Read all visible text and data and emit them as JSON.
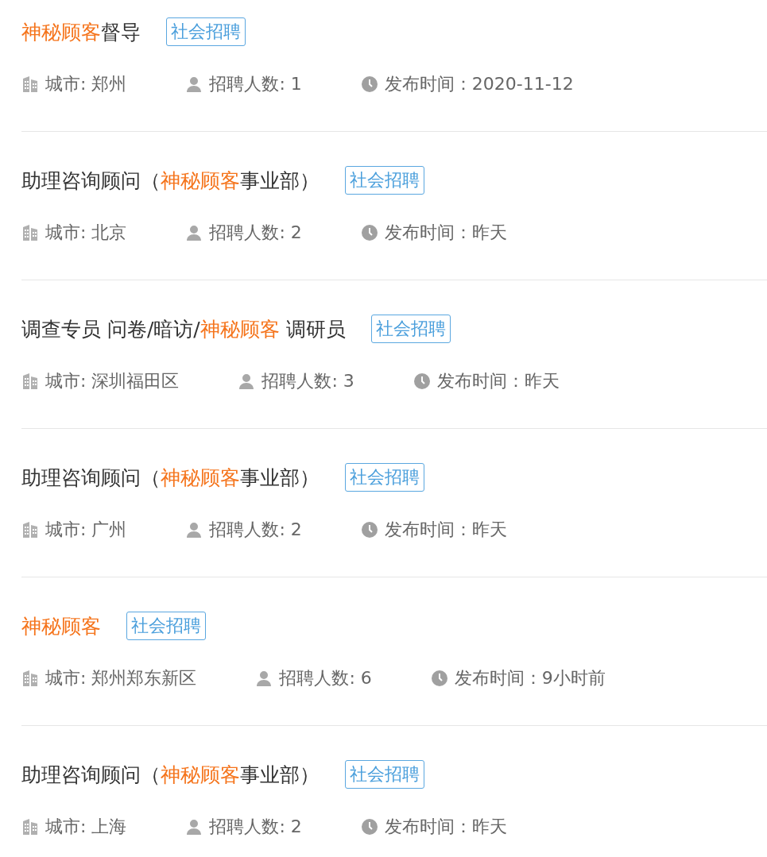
{
  "jobs": [
    {
      "title_parts": [
        {
          "text": "神秘顾客",
          "highlight": true
        },
        {
          "text": "督导",
          "highlight": false
        }
      ],
      "tag": "社会招聘",
      "city": "城市: 郑州",
      "headcount": "招聘人数: 1",
      "posted": "发布时间：2020-11-12"
    },
    {
      "title_parts": [
        {
          "text": "助理咨询顾问（",
          "highlight": false
        },
        {
          "text": "神秘顾客",
          "highlight": true
        },
        {
          "text": "事业部）",
          "highlight": false
        }
      ],
      "tag": "社会招聘",
      "city": "城市: 北京",
      "headcount": "招聘人数: 2",
      "posted": "发布时间：昨天"
    },
    {
      "title_parts": [
        {
          "text": "调查专员 问卷/暗访/",
          "highlight": false
        },
        {
          "text": "神秘顾客",
          "highlight": true
        },
        {
          "text": " 调研员",
          "highlight": false
        }
      ],
      "tag": "社会招聘",
      "city": "城市: 深圳福田区",
      "headcount": "招聘人数: 3",
      "posted": "发布时间：昨天"
    },
    {
      "title_parts": [
        {
          "text": "助理咨询顾问（",
          "highlight": false
        },
        {
          "text": "神秘顾客",
          "highlight": true
        },
        {
          "text": "事业部）",
          "highlight": false
        }
      ],
      "tag": "社会招聘",
      "city": "城市: 广州",
      "headcount": "招聘人数: 2",
      "posted": "发布时间：昨天"
    },
    {
      "title_parts": [
        {
          "text": "神秘顾客",
          "highlight": true
        }
      ],
      "tag": "社会招聘",
      "city": "城市: 郑州郑东新区",
      "headcount": "招聘人数: 6",
      "posted": "发布时间：9小时前"
    },
    {
      "title_parts": [
        {
          "text": "助理咨询顾问（",
          "highlight": false
        },
        {
          "text": "神秘顾客",
          "highlight": true
        },
        {
          "text": "事业部）",
          "highlight": false
        }
      ],
      "tag": "社会招聘",
      "city": "城市: 上海",
      "headcount": "招聘人数: 2",
      "posted": "发布时间：昨天"
    }
  ]
}
